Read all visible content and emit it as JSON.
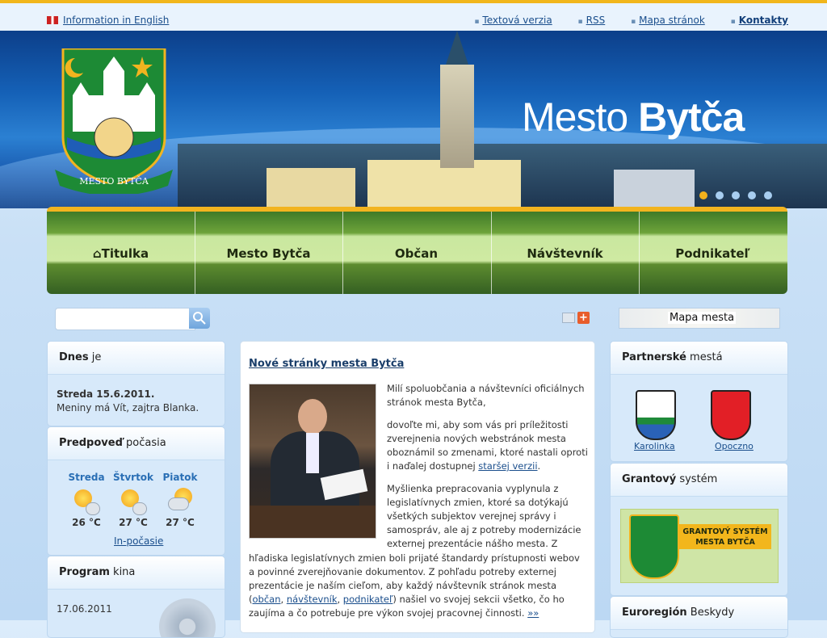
{
  "top": {
    "english_link": "Information in English",
    "links": [
      "Textová verzia",
      "RSS",
      "Mapa stránok",
      "Kontakty"
    ]
  },
  "banner": {
    "brand_word1": "Mesto",
    "brand_word2": "Bytča",
    "crest_caption": "MESTO BYTČA",
    "slider_active_index": 0,
    "slider_count": 5
  },
  "nav": [
    "Titulka",
    "Mesto Bytča",
    "Občan",
    "Návštevník",
    "Podnikateľ"
  ],
  "search": {
    "value": "",
    "placeholder": ""
  },
  "map_button": "Mapa mesta",
  "dnes": {
    "title_bold": "Dnes",
    "title_rest": " je",
    "date": "Streda 15.6.2011.",
    "names": "Meniny má Vít, zajtra Blanka."
  },
  "weather": {
    "title_bold": "Predpoveď",
    "title_rest": " počasia",
    "days": [
      {
        "day": "Streda",
        "temp": "26 °C",
        "icon": "sun-storm-icon"
      },
      {
        "day": "Štvrtok",
        "temp": "27 °C",
        "icon": "sun-storm-icon"
      },
      {
        "day": "Piatok",
        "temp": "27 °C",
        "icon": "cloud-sun-rain-icon"
      }
    ],
    "link": "In-počasie"
  },
  "kino": {
    "title_bold": "Program",
    "title_rest": " kina",
    "date": "17.06.2011"
  },
  "article": {
    "title": "Nové stránky mesta Bytča",
    "p1": "Milí spoluobčania a návštevníci oficiálnych stránok mesta Bytča,",
    "p2_a": "dovoľte mi, aby som vás pri príležitosti zverejnenia nových webstránok mesta oboznámil so  zmenami, ktoré nastali oproti i naďalej dostupnej ",
    "p2_link": "staršej verzii",
    "p2_b": ".",
    "p3": "Myšlienka prepracovania vyplynula z legislatívnych zmien, ktoré sa dotýkajú všetkých subjektov verejnej správy i samospráv, ale aj z potreby modernizácie externej prezentácie nášho mesta. Z",
    "p4": "hľadiska legislatívnych zmien boli prijaté štandardy prístupnosti webov a povinné zverejňovanie dokumentov. Z pohľadu potreby externej prezentácie je naším cieľom, aby každý návštevník stránok mesta (",
    "link_obcan": "občan",
    "link_navstevnik": "návštevník",
    "link_podnikatel": "podnikateľ",
    "p4_b": ") našiel vo svojej sekcii všetko, čo ho zaujíma a čo potrebuje pre výkon svojej pracovnej činnosti.",
    "more": "»»"
  },
  "partners": {
    "title_bold": "Partnerské",
    "title_rest": " mestá",
    "items": [
      "Karolinka",
      "Opoczno"
    ]
  },
  "grant": {
    "title_bold": "Grantový",
    "title_rest": " systém",
    "label": "GRANTOVÝ SYSTÉM MESTA BYTČA"
  },
  "euro": {
    "title_bold": "Euroregión",
    "title_rest": " Beskydy"
  },
  "colors": {
    "accent": "#f2b41f",
    "link": "#1a4e8c",
    "brand_blue": "#1561b7"
  }
}
